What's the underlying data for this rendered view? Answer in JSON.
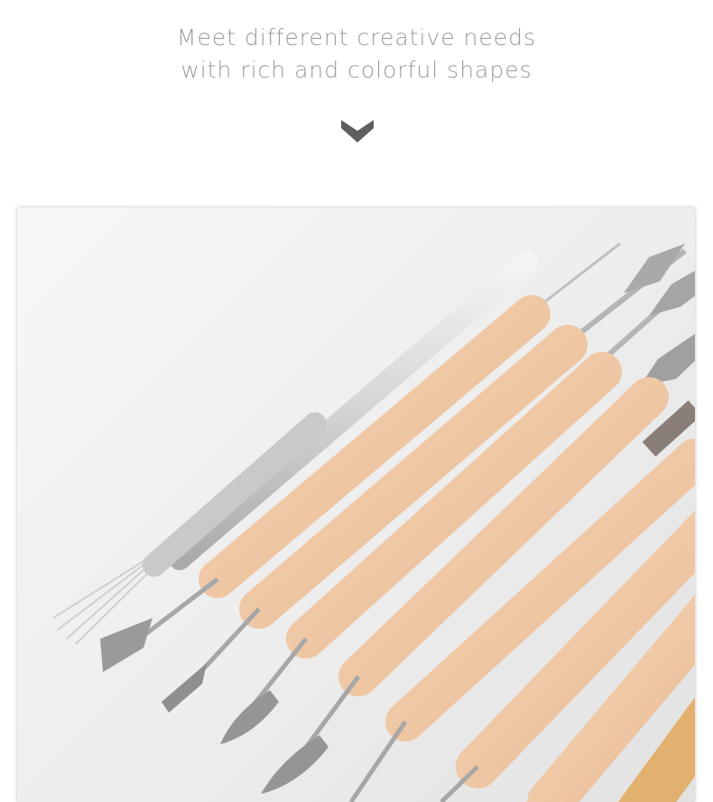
{
  "headline": {
    "line1": "Meet different creative needs",
    "line2": "with rich and colorful shapes"
  },
  "icons": {
    "scroll": "chevron-down-icon"
  },
  "photo": {
    "subject": "clay-sculpting-tools-photo"
  },
  "colors": {
    "headline_text": "#9a9a9a",
    "chevron": "#5f5f5f",
    "wood": "#efc9a8",
    "metal": "#b9b9b9"
  }
}
